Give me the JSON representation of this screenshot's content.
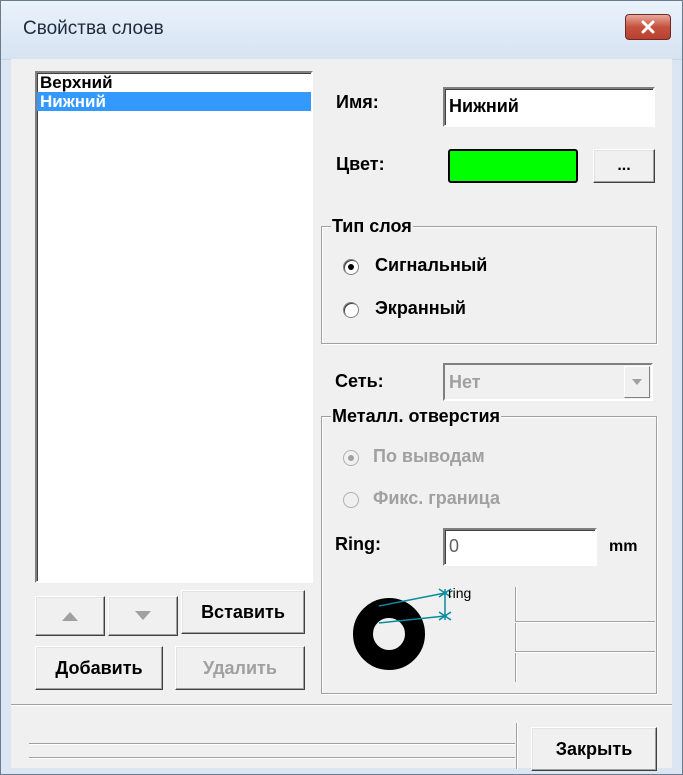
{
  "window": {
    "title": "Свойства слоев"
  },
  "layers": {
    "items": [
      "Верхний",
      "Нижний"
    ],
    "selected_index": 1
  },
  "buttons": {
    "up": "▲",
    "down": "▼",
    "insert": "Вставить",
    "add": "Добавить",
    "delete": "Удалить",
    "close": "Закрыть",
    "color_browse": "..."
  },
  "props": {
    "name_label": "Имя:",
    "name_value": "Нижний",
    "color_label": "Цвет:",
    "color_value": "#00ff00"
  },
  "layer_type": {
    "group_label": "Тип слоя",
    "signal": "Сигнальный",
    "screen": "Экранный",
    "selected": "signal"
  },
  "net": {
    "label": "Сеть:",
    "value": "Нет"
  },
  "metal_holes": {
    "group_label": "Металл. отверстия",
    "by_pins": "По выводам",
    "fixed_border": "Фикс. граница",
    "selected": "by_pins",
    "ring_label": "Ring:",
    "ring_value": "0",
    "ring_unit": "mm",
    "ring_diagram_label": "ring"
  }
}
